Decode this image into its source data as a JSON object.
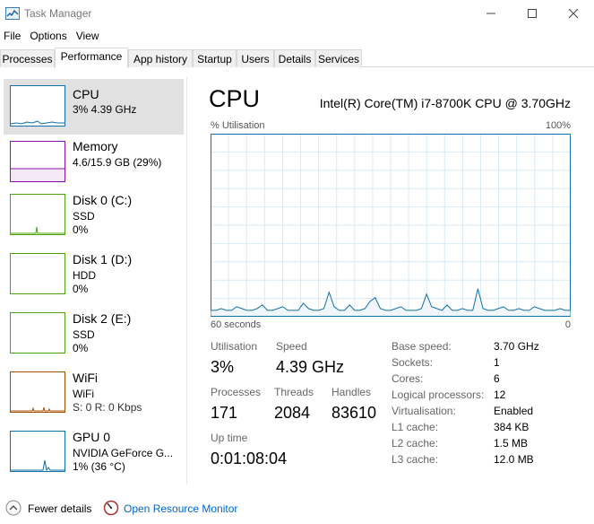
{
  "window": {
    "title": "Task Manager"
  },
  "menu": [
    "File",
    "Options",
    "View"
  ],
  "tabs": [
    "Processes",
    "Performance",
    "App history",
    "Startup",
    "Users",
    "Details",
    "Services"
  ],
  "active_tab": "Performance",
  "colors": {
    "cpu": "#1170aa",
    "cpu_fill": "#f1f6fa",
    "memory": "#8b12ae",
    "disk": "#4da60c",
    "wifi": "#a74f01",
    "gpu": "#1170aa",
    "selected": "#e1e1e1",
    "link": "#0066cc"
  },
  "sidebar": {
    "items": [
      {
        "name": "CPU",
        "line1": "3% 4.39 GHz",
        "line2": "",
        "icon": "cpu-graph-icon"
      },
      {
        "name": "Memory",
        "line1": "4.6/15.9 GB (29%)",
        "line2": "",
        "icon": "memory-graph-icon"
      },
      {
        "name": "Disk 0 (C:)",
        "line1": "SSD",
        "line2": "0%",
        "icon": "disk-graph-icon"
      },
      {
        "name": "Disk 1 (D:)",
        "line1": "HDD",
        "line2": "0%",
        "icon": "disk-graph-icon"
      },
      {
        "name": "Disk 2 (E:)",
        "line1": "SSD",
        "line2": "0%",
        "icon": "disk-graph-icon"
      },
      {
        "name": "WiFi",
        "line1": "WiFi",
        "line2": "S: 0 R: 0 Kbps",
        "icon": "wifi-graph-icon"
      },
      {
        "name": "GPU 0",
        "line1": "NVIDIA GeForce G...",
        "line2": "1% (36 °C)",
        "icon": "gpu-graph-icon"
      }
    ]
  },
  "main": {
    "title": "CPU",
    "model": "Intel(R) Core(TM) i7-8700K CPU @ 3.70GHz",
    "graph_label_top_left": "% Utilisation",
    "graph_label_top_right": "100%",
    "graph_label_bottom_left": "60 seconds",
    "graph_label_bottom_right": "0",
    "utilisation_history": [
      3,
      3,
      4,
      3,
      3,
      5,
      4,
      3,
      3,
      4,
      6,
      3,
      3,
      4,
      5,
      3,
      3,
      3,
      7,
      4,
      3,
      3,
      4,
      13,
      5,
      3,
      3,
      6,
      3,
      3,
      4,
      8,
      10,
      4,
      3,
      3,
      4,
      5,
      3,
      3,
      3,
      4,
      12,
      5,
      4,
      3,
      6,
      3,
      3,
      4,
      3,
      3,
      15,
      4,
      3,
      3,
      4,
      5,
      3,
      3,
      4,
      3,
      3,
      5,
      4,
      3,
      3,
      3,
      4,
      3,
      3
    ]
  },
  "stats": {
    "utilisation_label": "Utilisation",
    "utilisation": "3%",
    "speed_label": "Speed",
    "speed": "4.39 GHz",
    "processes_label": "Processes",
    "processes": "171",
    "threads_label": "Threads",
    "threads": "2084",
    "handles_label": "Handles",
    "handles": "83610",
    "uptime_label": "Up time",
    "uptime": "0:01:08:04"
  },
  "specs": [
    {
      "label": "Base speed:",
      "value": "3.70 GHz"
    },
    {
      "label": "Sockets:",
      "value": "1"
    },
    {
      "label": "Cores:",
      "value": "6"
    },
    {
      "label": "Logical processors:",
      "value": "12"
    },
    {
      "label": "Virtualisation:",
      "value": "Enabled"
    },
    {
      "label": "L1 cache:",
      "value": "384 KB"
    },
    {
      "label": "L2 cache:",
      "value": "1.5 MB"
    },
    {
      "label": "L3 cache:",
      "value": "12.0 MB"
    }
  ],
  "footer": {
    "fewer_details": "Fewer details",
    "resource_monitor": "Open Resource Monitor"
  }
}
